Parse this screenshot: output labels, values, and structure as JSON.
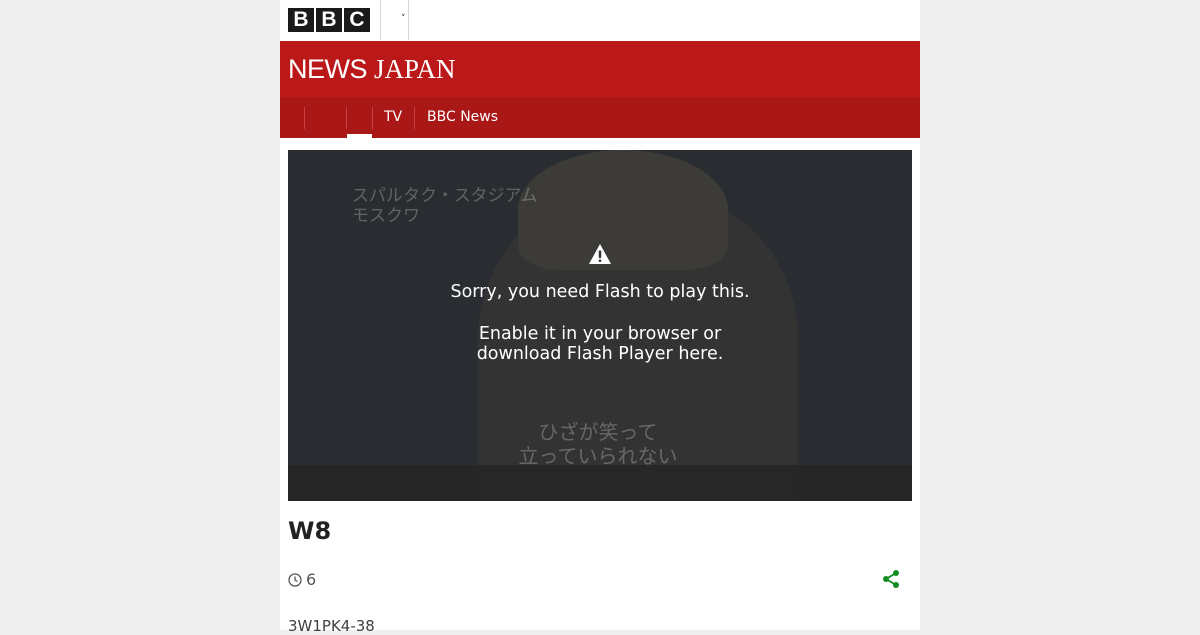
{
  "header": {
    "logo_letters": [
      "B",
      "B",
      "C"
    ],
    "masthead_news": "NEWS",
    "masthead_region": "JAPAN"
  },
  "nav": {
    "items": [
      {
        "label": "TV"
      },
      {
        "label": "BBC News"
      }
    ]
  },
  "video": {
    "caption_jp_line1": "スパルタク・スタジアム",
    "caption_jp_line2": "モスクワ",
    "subtitle_jp_line1": "ひざが笑って",
    "subtitle_jp_line2": "立っていられない",
    "message_line1": "Sorry, you need Flash to play this.",
    "message_line2": "Enable it in your browser or download Flash Player here.",
    "icons": {
      "warning": "warning-icon"
    }
  },
  "article": {
    "title": "W8",
    "timestamp": "6",
    "summary": "3W1PK4-38",
    "icons": {
      "clock": "clock-icon",
      "share": "share-icon"
    }
  },
  "colors": {
    "brand_red": "#bb1919",
    "nav_red": "#a91717",
    "share_green": "#138c23"
  }
}
